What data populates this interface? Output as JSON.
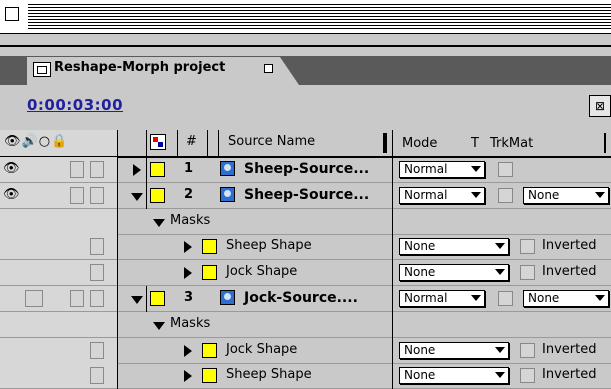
{
  "window": {
    "project_tab": "Reshape-Morph project",
    "timecode": "0:00:03:00",
    "comp_button_label": "⊠"
  },
  "header": {
    "switch_icons": "👁🔊○🔒",
    "hash": "#",
    "source_name": "Source Name",
    "mode": "Mode",
    "t": "T",
    "trkmat": "TrkMat"
  },
  "rows": [
    {
      "kind": "layer",
      "num": "1",
      "name": "Sheep-Source...",
      "mode": "Normal",
      "trkmat": "",
      "expanded": false,
      "eye": true
    },
    {
      "kind": "layer",
      "num": "2",
      "name": "Sheep-Source...",
      "mode": "Normal",
      "trkmat": "None",
      "expanded": true,
      "eye": true
    },
    {
      "kind": "group",
      "name": "Masks"
    },
    {
      "kind": "mask",
      "name": "Sheep Shape",
      "mode": "None",
      "inverted": "Inverted"
    },
    {
      "kind": "mask",
      "name": "Jock Shape",
      "mode": "None",
      "inverted": "Inverted"
    },
    {
      "kind": "layer",
      "num": "3",
      "name": "Jock-Source....",
      "mode": "Normal",
      "trkmat": "None",
      "expanded": true,
      "eye": false
    },
    {
      "kind": "group",
      "name": "Masks"
    },
    {
      "kind": "mask",
      "name": "Jock Shape",
      "mode": "None",
      "inverted": "Inverted"
    },
    {
      "kind": "mask",
      "name": "Sheep Shape",
      "mode": "None",
      "inverted": "Inverted"
    }
  ],
  "colors": {
    "label_yellow": "#ffff00",
    "timecode_blue": "#2020a0",
    "source_icon": "#2c6fd0"
  }
}
